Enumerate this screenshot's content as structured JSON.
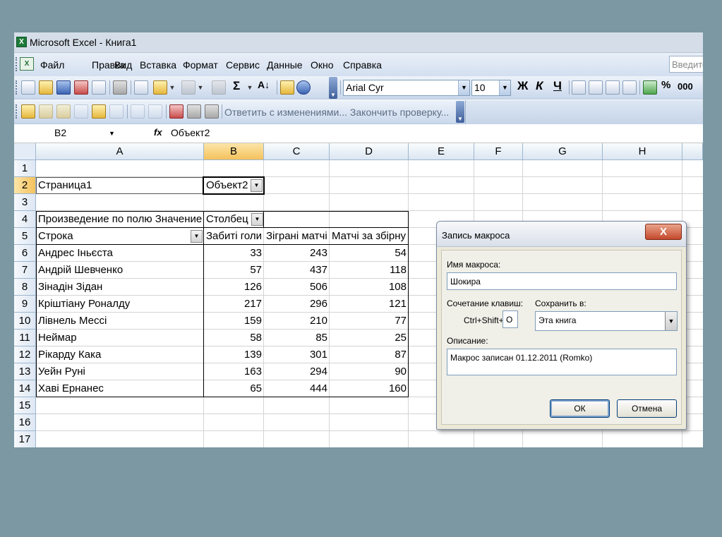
{
  "window": {
    "title": "Microsoft Excel - Книга1",
    "app_icon": "X"
  },
  "menubar": {
    "doc_icon": "X",
    "items": [
      "Файл",
      "Правка",
      "Вид",
      "Вставка",
      "Формат",
      "Сервис",
      "Данные",
      "Окно",
      "Справка"
    ],
    "help_placeholder": "Введите"
  },
  "toolbar": {
    "font_name": "Arial Cyr",
    "font_size": "10",
    "bold": "Ж",
    "italic": "К",
    "underline": "Ч",
    "sigma": "Σ",
    "sort": "А↓",
    "percent": "%",
    "thousands": "000",
    "reviewing_text": "Ответить с изменениями... Закончить проверку..."
  },
  "formula_bar": {
    "name_box": "B2",
    "fx": "fx",
    "value": "Объект2"
  },
  "grid": {
    "columns": [
      "A",
      "B",
      "C",
      "D",
      "E",
      "F",
      "G",
      "H"
    ],
    "rows": [
      "1",
      "2",
      "3",
      "4",
      "5",
      "6",
      "7",
      "8",
      "9",
      "10",
      "11",
      "12",
      "13",
      "14",
      "15",
      "16",
      "17"
    ],
    "page_label": "Страница1",
    "page_value": "Объект2",
    "pivot_data_label": "Произведение по полю Значение",
    "pivot_column_label": "Столбец",
    "pivot_row_label": "Строка",
    "headers": [
      "Забиті голи",
      "Зіграні матчі",
      "Матчі за збірну"
    ],
    "data_rows": [
      {
        "name": "Андрес Іньєста",
        "values": [
          "33",
          "243",
          "54"
        ]
      },
      {
        "name": "Андрій Шевченко",
        "values": [
          "57",
          "437",
          "118"
        ]
      },
      {
        "name": "Зінадін Зідан",
        "values": [
          "126",
          "506",
          "108"
        ]
      },
      {
        "name": "Кріштіану Роналду",
        "values": [
          "217",
          "296",
          "121"
        ]
      },
      {
        "name": "Лівнель Мессі",
        "values": [
          "159",
          "210",
          "77"
        ]
      },
      {
        "name": "Неймар",
        "values": [
          "58",
          "85",
          "25"
        ]
      },
      {
        "name": "Рікарду Кака",
        "values": [
          "139",
          "301",
          "87"
        ]
      },
      {
        "name": "Уейн Руні",
        "values": [
          "163",
          "294",
          "90"
        ]
      },
      {
        "name": "Хаві Ернанес",
        "values": [
          "65",
          "444",
          "160"
        ]
      }
    ]
  },
  "dialog": {
    "title": "Запись макроса",
    "close": "X",
    "macro_name_label": "Имя макроса:",
    "macro_name_value": "Шокира",
    "shortcut_label": "Сочетание клавиш:",
    "shortcut_prefix": "Ctrl+Shift+",
    "shortcut_value": "O",
    "store_in_label": "Сохранить в:",
    "store_in_value": "Эта книга",
    "description_label": "Описание:",
    "description_value": "Макрос записан 01.12.2011 (Romko)",
    "ok_label": "ОК",
    "cancel_label": "Отмена"
  }
}
